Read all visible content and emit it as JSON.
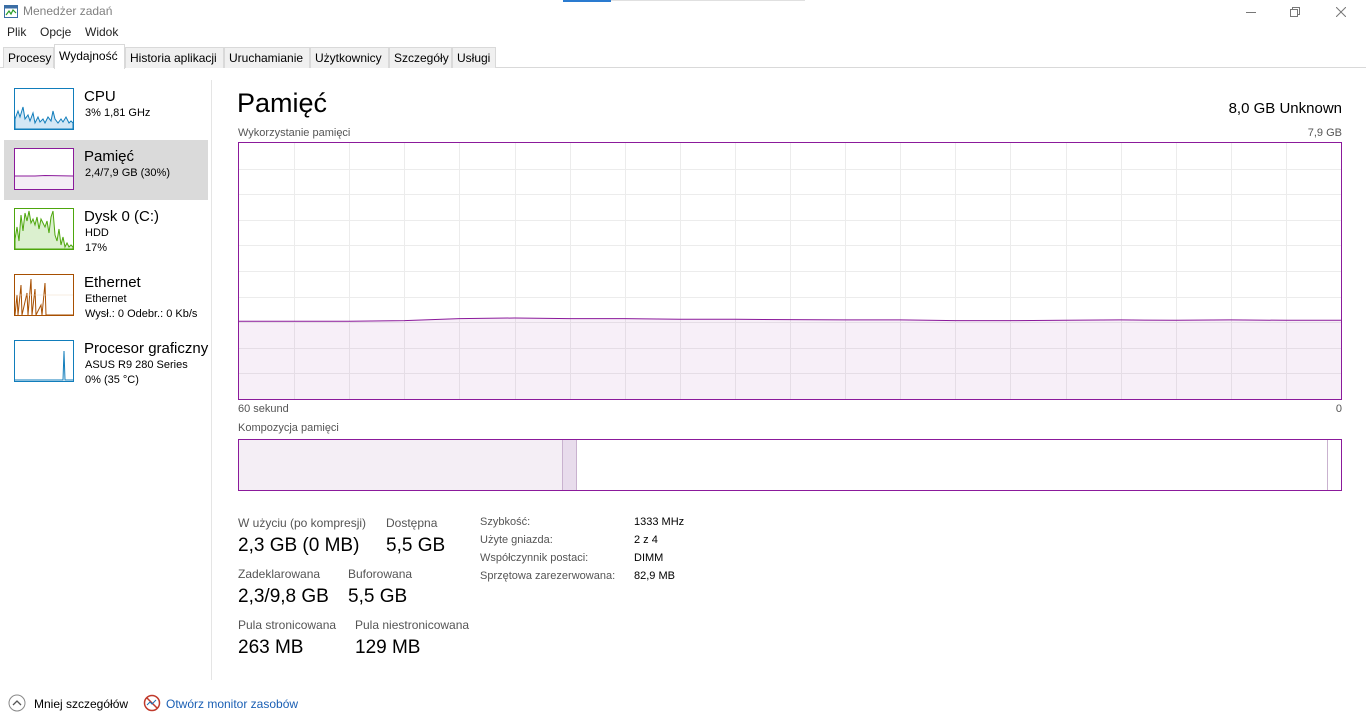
{
  "window": {
    "title": "Menedżer zadań",
    "icon": "task-manager-icon"
  },
  "menu": {
    "items": [
      "Plik",
      "Opcje",
      "Widok"
    ]
  },
  "tabs": {
    "items": [
      "Procesy",
      "Wydajność",
      "Historia aplikacji",
      "Uruchamianie",
      "Użytkownicy",
      "Szczegóły",
      "Usługi"
    ],
    "active": "Wydajność"
  },
  "sidebar": {
    "cpu": {
      "name": "CPU",
      "line1": "3% 1,81 GHz",
      "color": "#117dbb"
    },
    "memory": {
      "name": "Pamięć",
      "line1": "2,4/7,9 GB (30%)",
      "color": "#8b1a9b",
      "usage_fraction": 0.3
    },
    "disk": {
      "name": "Dysk 0 (C:)",
      "line1": "HDD",
      "line2": "17%",
      "color": "#4da60c"
    },
    "ethernet": {
      "name": "Ethernet",
      "line1": "Ethernet",
      "send_label": "Wysł.:",
      "send_value": "0",
      "recv_label": "Odebr.:",
      "recv_value": "0 Kb/s",
      "color": "#a74f01"
    },
    "gpu": {
      "name": "Procesor graficzny",
      "line1": "ASUS R9 280 Series",
      "line2": "0% (35 °C)",
      "color": "#117dbb"
    }
  },
  "main": {
    "title": "Pamięć",
    "spec": "8,0 GB Unknown",
    "graph_label": "Wykorzystanie pamięci",
    "graph_max": "7,9 GB",
    "graph_x_left": "60 sekund",
    "graph_x_right": "0",
    "composition_label": "Kompozycja pamięci"
  },
  "chart_data": {
    "type": "area",
    "title": "Wykorzystanie pamięci",
    "x_unit": "seconds ago",
    "x": [
      60,
      57,
      54,
      51,
      48,
      45,
      42,
      39,
      36,
      33,
      30,
      27,
      24,
      21,
      18,
      15,
      12,
      9,
      6,
      3,
      0
    ],
    "ylim": [
      0,
      7.9
    ],
    "y_unit": "GB",
    "series": [
      {
        "values": [
          2.4,
          2.4,
          2.4,
          2.42,
          2.48,
          2.5,
          2.48,
          2.48,
          2.46,
          2.46,
          2.45,
          2.44,
          2.44,
          2.42,
          2.42,
          2.43,
          2.44,
          2.43,
          2.44,
          2.43,
          2.43
        ],
        "color": "#8b1a9b"
      }
    ],
    "grid": true
  },
  "composition": {
    "in_use_fraction": 0.294,
    "modified_fraction": 0.013,
    "standby_fraction": 0.679,
    "free_fraction": 0.014
  },
  "stats": {
    "in_use_label": "W użyciu (po kompresji)",
    "in_use_value": "2,3 GB (0 MB)",
    "available_label": "Dostępna",
    "available_value": "5,5 GB",
    "committed_label": "Zadeklarowana",
    "committed_value": "2,3/9,8 GB",
    "cached_label": "Buforowana",
    "cached_value": "5,5 GB",
    "paged_label": "Pula stronicowana",
    "paged_value": "263 MB",
    "nonpaged_label": "Pula niestronicowana",
    "nonpaged_value": "129 MB"
  },
  "specs": [
    {
      "label": "Szybkość:",
      "value": "1333 MHz"
    },
    {
      "label": "Użyte gniazda:",
      "value": "2 z 4"
    },
    {
      "label": "Współczynnik postaci:",
      "value": "DIMM"
    },
    {
      "label": "Sprzętowa zarezerwowana:",
      "value": "82,9 MB"
    }
  ],
  "footer": {
    "less_details": "Mniej szczegółów",
    "resource_monitor": "Otwórz monitor zasobów"
  }
}
